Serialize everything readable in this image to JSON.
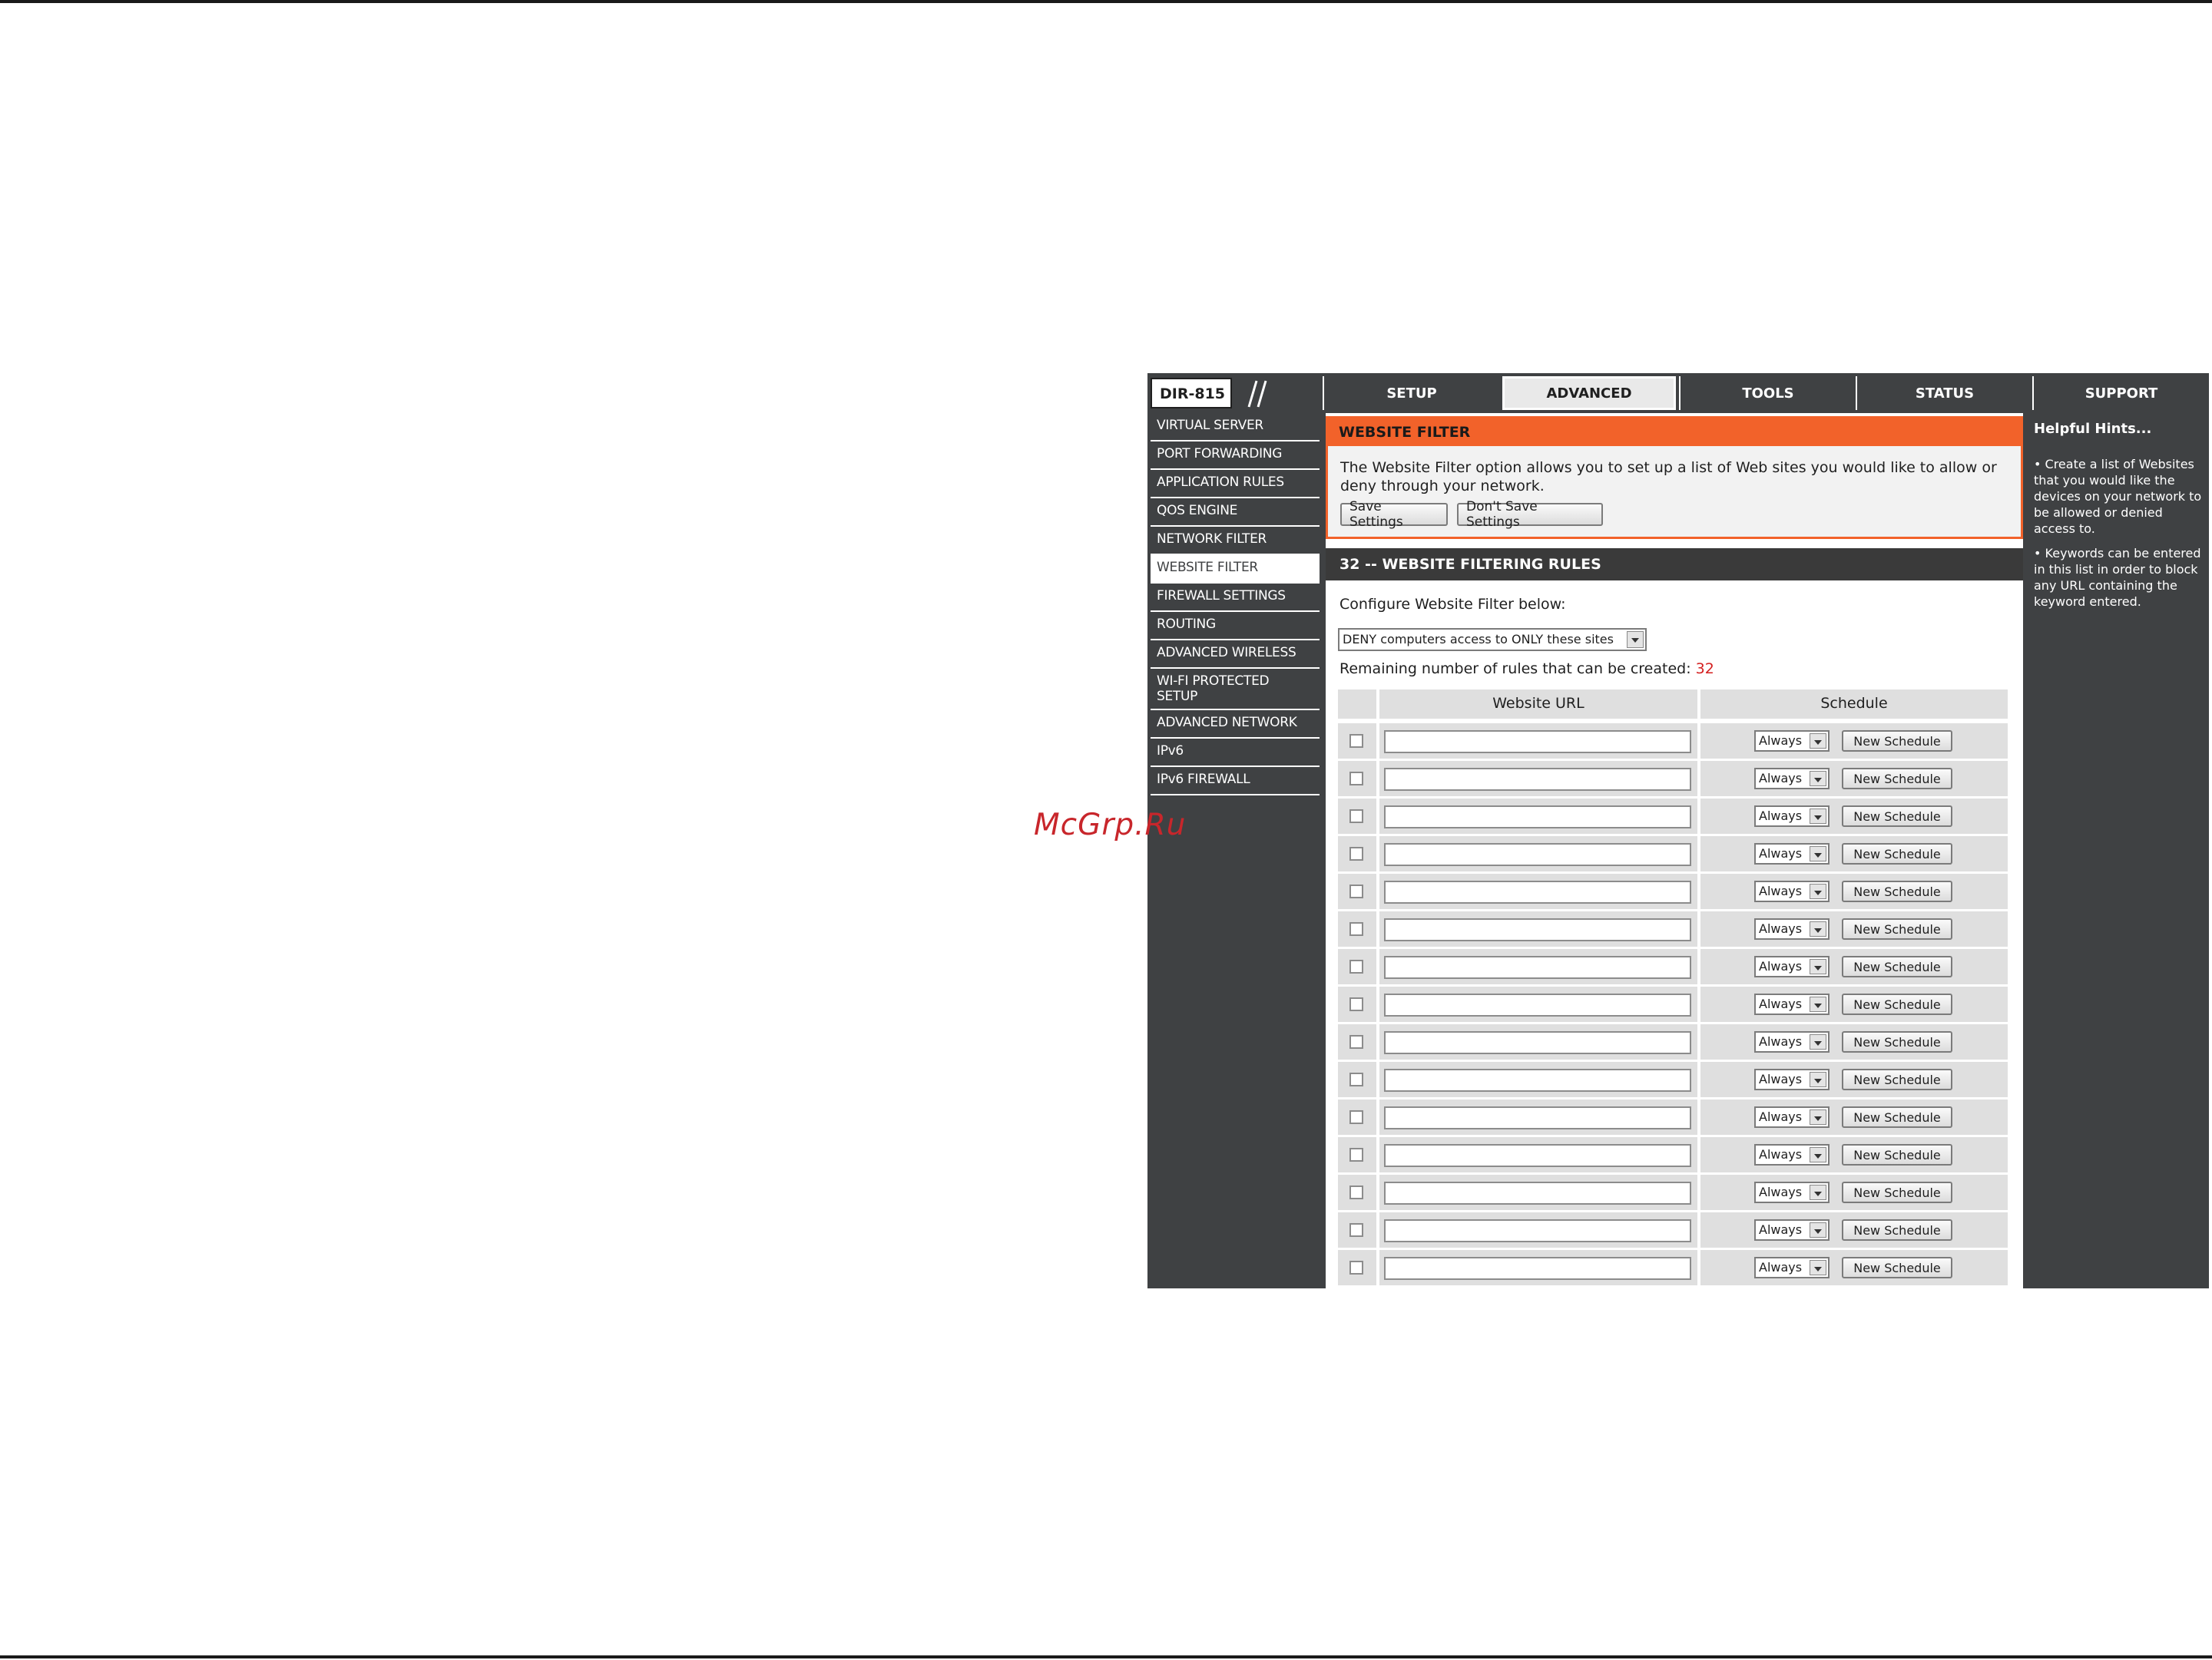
{
  "watermark": "McGrp.Ru",
  "router": {
    "model": "DIR-815",
    "nav": [
      "SETUP",
      "ADVANCED",
      "TOOLS",
      "STATUS",
      "SUPPORT"
    ],
    "sidebar": [
      "VIRTUAL SERVER",
      "PORT FORWARDING",
      "APPLICATION RULES",
      "QOS ENGINE",
      "NETWORK FILTER",
      "WEBSITE FILTER",
      "FIREWALL SETTINGS",
      "ROUTING",
      "ADVANCED WIRELESS",
      "WI-FI PROTECTED SETUP",
      "ADVANCED NETWORK",
      "IPv6",
      "IPv6 FIREWALL"
    ],
    "active_sidebar": "WEBSITE FILTER",
    "active_tab": "ADVANCED"
  },
  "website_filter": {
    "title": "WEBSITE FILTER",
    "description": "The Website Filter option allows you to set up a list of Web sites you would like to allow or deny through your network.",
    "save_label": "Save Settings",
    "dont_save_label": "Don't Save Settings"
  },
  "rules": {
    "title": "32 -- WEBSITE FILTERING RULES",
    "configure_label": "Configure Website Filter below:",
    "filter_mode": "DENY computers access to ONLY these sites",
    "remaining_label": "Remaining number of rules that can be created:",
    "remaining_count": "32",
    "col_url": "Website URL",
    "col_schedule": "Schedule",
    "schedule_value": "Always",
    "new_schedule_label": "New Schedule",
    "row_count": 15
  },
  "hints": {
    "title": "Helpful Hints...",
    "items": [
      "Create a list of Websites that you would like the devices on your network to be allowed or denied access to.",
      "Keywords can be entered in this list in order to block any URL containing the keyword entered."
    ]
  }
}
